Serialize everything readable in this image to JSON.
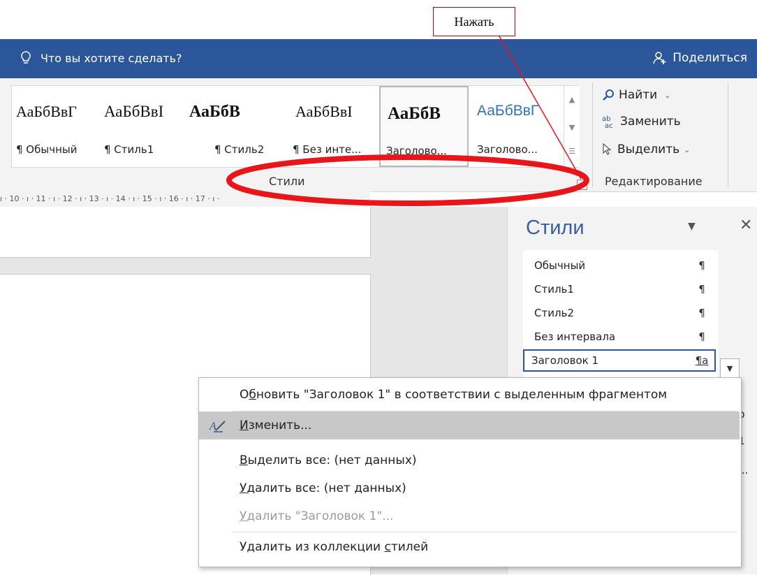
{
  "callout": {
    "text": "Нажать"
  },
  "titlebar": {
    "tell_me": "Что вы хотите сделать?",
    "share": "Поделиться",
    "bg_color": "#2b579a"
  },
  "ribbon": {
    "gallery": [
      {
        "preview": "АаБбВвГ",
        "name": "¶ Обычный",
        "selected": false
      },
      {
        "preview": "АаБбВвІ",
        "name": "¶ Стиль1",
        "selected": false
      },
      {
        "preview": "АаБбВ",
        "name": "¶ Стиль2",
        "selected": false
      },
      {
        "preview": "АаБбВвІ",
        "name": "¶ Без инте...",
        "selected": false
      },
      {
        "preview": "АаБбВ",
        "name": "Заголово...",
        "selected": true
      },
      {
        "preview": "АаБбВвГ",
        "name": "Заголово...",
        "selected": false
      }
    ],
    "styles_group_label": "Стили",
    "editing": {
      "find": "Найти",
      "replace": "Заменить",
      "select": "Выделить",
      "group_label": "Редактирование"
    }
  },
  "ruler": {
    "text": "ı · 10 · ı · 11 · ı · 12 · ı · 13 · ı · 14 · ı · 15 · ı · 16 · ı · 17 · ı ·"
  },
  "styles_pane": {
    "title": "Стили",
    "items": [
      {
        "name": "Обычный",
        "mark": "¶",
        "selected": false
      },
      {
        "name": "Стиль1",
        "mark": "¶",
        "selected": false
      },
      {
        "name": "Стиль2",
        "mark": "¶",
        "selected": false
      },
      {
        "name": "Без интервала",
        "mark": "¶",
        "selected": false
      },
      {
        "name": "Заголовок 1",
        "mark": "¶a",
        "selected": true
      }
    ],
    "peek_1": "р",
    "peek_2": "1",
    "peek_3": "..."
  },
  "context_menu": {
    "items": [
      {
        "pre": "О",
        "ul": "б",
        "post": "новить \"Заголовок 1\" в соответствии с выделенным фрагментом",
        "disabled": false,
        "highlighted": false
      },
      {
        "pre": "",
        "ul": "И",
        "post": "зменить...",
        "disabled": false,
        "highlighted": true
      },
      {
        "pre": "",
        "ul": "В",
        "post": "ыделить все: (нет данных)",
        "disabled": false,
        "highlighted": false
      },
      {
        "pre": "",
        "ul": "У",
        "post": "далить все: (нет данных)",
        "disabled": false,
        "highlighted": false
      },
      {
        "pre": "",
        "ul": "У",
        "post": "далить \"Заголовок 1\"...",
        "disabled": true,
        "highlighted": false
      },
      {
        "pre": "Удалить из коллекции ",
        "ul": "с",
        "post": "тилей",
        "disabled": false,
        "highlighted": false
      }
    ]
  },
  "annotation_color": "#e8151b"
}
